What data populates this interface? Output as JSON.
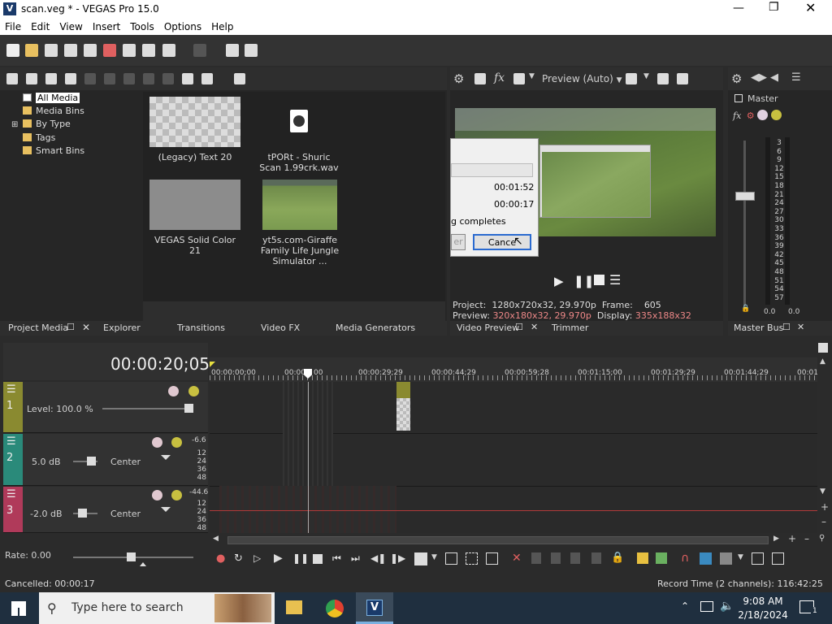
{
  "window": {
    "title": "scan.veg * - VEGAS Pro 15.0",
    "app_icon": "V"
  },
  "menu": [
    "File",
    "Edit",
    "View",
    "Insert",
    "Tools",
    "Options",
    "Help"
  ],
  "media_tree": {
    "items": [
      "All Media",
      "Media Bins",
      "By Type",
      "Tags",
      "Smart Bins"
    ]
  },
  "media_items": [
    {
      "label": "(Legacy) Text 20"
    },
    {
      "label": "tPORt - Shuric Scan 1.99crk.wav"
    },
    {
      "label": "VEGAS Solid Color 21"
    },
    {
      "label": "yt5s.com-Giraffe Family Life Jungle Simulator ..."
    }
  ],
  "left_tabs": [
    "Project Media",
    "Explorer",
    "Transitions",
    "Video FX",
    "Media Generators"
  ],
  "preview": {
    "mode": "Preview (Auto)",
    "project_label": "Project:",
    "project_value": "1280x720x32, 29.970p",
    "frame_label": "Frame:",
    "frame_value": "605",
    "preview_label": "Preview:",
    "preview_value": "320x180x32, 29.970p",
    "display_label": "Display:",
    "display_value": "335x188x32",
    "tabs": [
      "Video Preview",
      "Trimmer"
    ]
  },
  "render_dialog": {
    "time1": "00:01:52",
    "time2": "00:00:17",
    "partial_text": "g completes",
    "partial_button": "er",
    "cancel": "Cance"
  },
  "master_bus": {
    "title": "Master",
    "scale": [
      "3",
      "6",
      "9",
      "12",
      "15",
      "18",
      "21",
      "24",
      "27",
      "30",
      "33",
      "36",
      "39",
      "42",
      "45",
      "48",
      "51",
      "54",
      "57"
    ],
    "left_value": "0.0",
    "right_value": "0.0",
    "tab": "Master Bus"
  },
  "timeline": {
    "timecode": "00:00:20;05",
    "ruler": [
      "00:00:00;00",
      "00:00:",
      "00",
      "00:00:29;29",
      "00:00:44;29",
      "00:00:59;28",
      "00:01:15;00",
      "00:01:29;29",
      "00:01:44;29",
      "00:01"
    ],
    "rate_label": "Rate: 0.00"
  },
  "tracks": [
    {
      "num": "1",
      "level": "Level: 100.0 %",
      "color": "#8a8a30"
    },
    {
      "num": "2",
      "volume": "5.0 dB",
      "pan": "Center",
      "peak": "-6.6",
      "meter": [
        "12",
        "24",
        "36",
        "48"
      ],
      "color": "#2a8a7a"
    },
    {
      "num": "3",
      "volume": "-2.0 dB",
      "pan": "Center",
      "peak": "-44.6",
      "meter": [
        "12",
        "24",
        "36",
        "48"
      ],
      "color": "#b03a5a"
    }
  ],
  "status": {
    "left": "Cancelled: 00:00:17",
    "right": "Record Time (2 channels): 116:42:25"
  },
  "taskbar": {
    "search": "Type here to search",
    "time": "9:08 AM",
    "date": "2/18/2024",
    "notif": "1"
  }
}
